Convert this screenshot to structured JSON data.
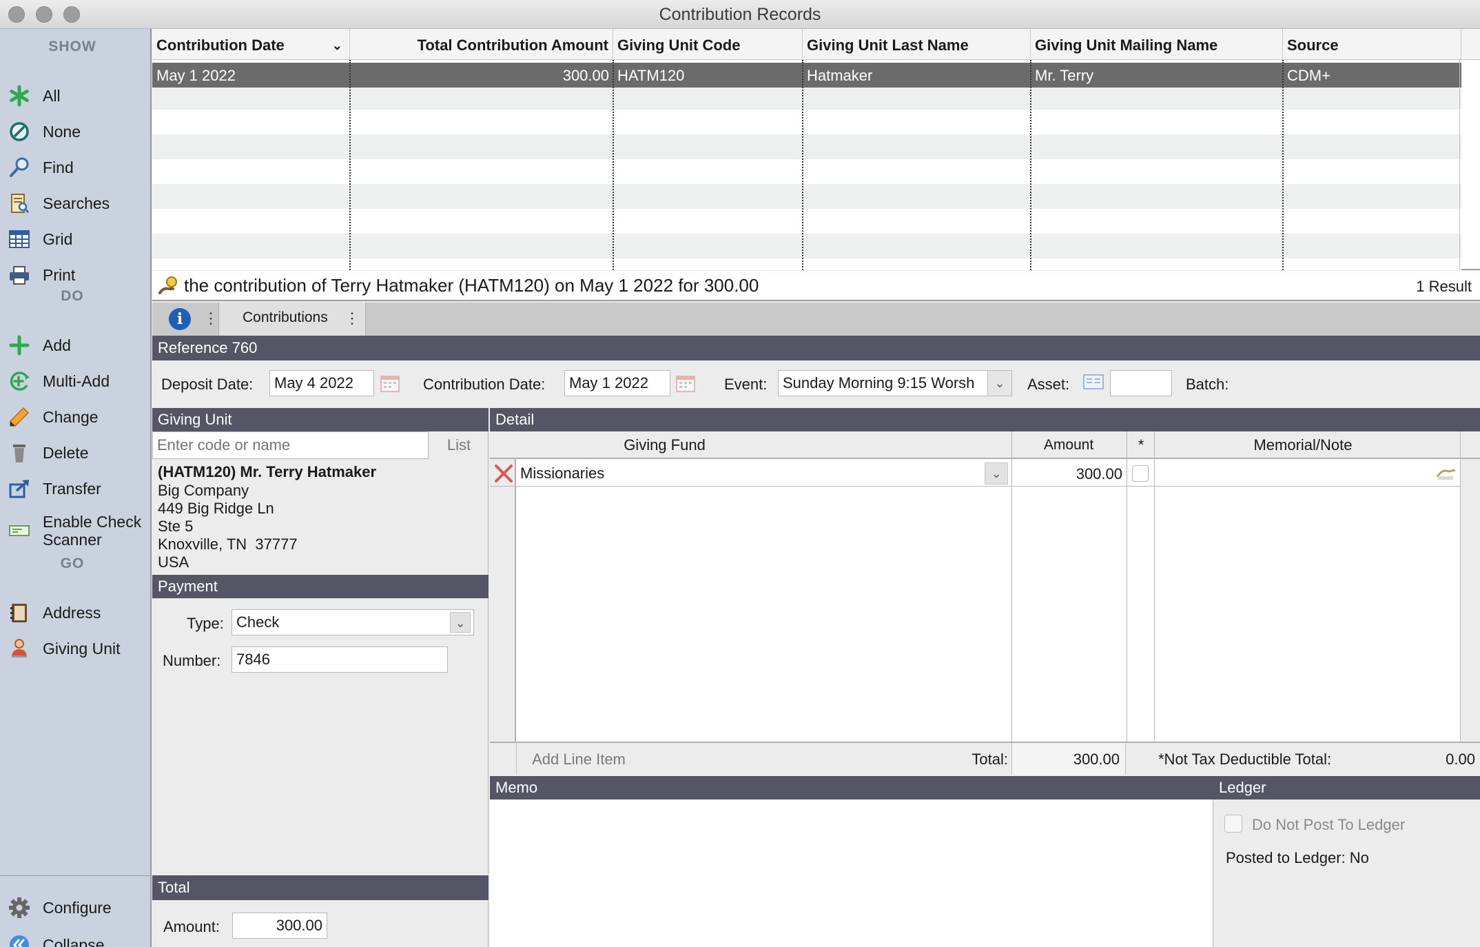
{
  "window": {
    "title": "Contribution Records"
  },
  "sidebar": {
    "show_title": "SHOW",
    "show_items": [
      {
        "label": "All",
        "icon": "asterisk-icon"
      },
      {
        "label": "None",
        "icon": "none-circle-icon"
      },
      {
        "label": "Find",
        "icon": "magnifier-icon"
      },
      {
        "label": "Searches",
        "icon": "searches-icon"
      },
      {
        "label": "Grid",
        "icon": "grid-icon"
      },
      {
        "label": "Print",
        "icon": "printer-icon"
      }
    ],
    "do_title": "DO",
    "do_items": [
      {
        "label": "Add",
        "icon": "plus-icon"
      },
      {
        "label": "Multi-Add",
        "icon": "multi-add-icon"
      },
      {
        "label": "Change",
        "icon": "pencil-icon"
      },
      {
        "label": "Delete",
        "icon": "trash-icon"
      },
      {
        "label": "Transfer",
        "icon": "transfer-icon"
      },
      {
        "label": "Enable Check Scanner",
        "icon": "check-scanner-icon"
      }
    ],
    "go_title": "GO",
    "go_items": [
      {
        "label": "Address",
        "icon": "address-book-icon"
      },
      {
        "label": "Giving Unit",
        "icon": "person-icon"
      }
    ],
    "bottom_items": [
      {
        "label": "Configure",
        "icon": "gear-icon"
      },
      {
        "label": "Collapse",
        "icon": "collapse-icon"
      }
    ]
  },
  "grid": {
    "columns": [
      "Contribution Date",
      "Total Contribution Amount",
      "Giving Unit Code",
      "Giving Unit Last Name",
      "Giving Unit Mailing Name",
      "Source"
    ],
    "rows": [
      [
        "May 1 2022",
        "300.00",
        "HATM120",
        "Hatmaker",
        "Mr. Terry",
        "CDM+"
      ]
    ]
  },
  "summary": {
    "text": "the contribution of Terry Hatmaker (HATM120) on May 1 2022 for 300.00",
    "result_count": "1 Result"
  },
  "tabs": {
    "active": "Contributions"
  },
  "reference": {
    "label": "Reference 760"
  },
  "header_fields": {
    "deposit_date_label": "Deposit Date:",
    "deposit_date": "May 4 2022",
    "contribution_date_label": "Contribution Date:",
    "contribution_date": "May 1 2022",
    "event_label": "Event:",
    "event": "Sunday Morning 9:15 Worsh",
    "asset_label": "Asset:",
    "asset": "",
    "batch_label": "Batch:"
  },
  "giving_unit": {
    "title": "Giving Unit",
    "search_placeholder": "Enter code or name",
    "list_button": "List",
    "name": "(HATM120) Mr. Terry Hatmaker",
    "address_lines": [
      "Big Company",
      "449 Big Ridge Ln",
      "Ste 5",
      "Knoxville, TN  37777",
      "USA"
    ]
  },
  "payment": {
    "title": "Payment",
    "type_label": "Type:",
    "type": "Check",
    "number_label": "Number:",
    "number": "7846"
  },
  "total_section": {
    "title": "Total",
    "amount_label": "Amount:",
    "amount": "300.00"
  },
  "detail": {
    "title": "Detail",
    "columns": {
      "fund": "Giving Fund",
      "amount": "Amount",
      "star": "*",
      "memo": "Memorial/Note"
    },
    "lines": [
      {
        "fund": "Missionaries",
        "amount": "300.00",
        "note": ""
      }
    ],
    "add_line": "Add Line Item",
    "total_label": "Total:",
    "total": "300.00",
    "ntd_label": "*Not Tax Deductible Total:",
    "ntd_total": "0.00"
  },
  "memo": {
    "title": "Memo",
    "text": ""
  },
  "ledger": {
    "title": "Ledger",
    "do_not_post_label": "Do Not Post To Ledger",
    "posted_status": "Posted to Ledger: No"
  },
  "colors": {
    "section_bar": "#555566",
    "selected_row": "#6b6b6b",
    "sidebar_bg": "#c9d2de"
  }
}
